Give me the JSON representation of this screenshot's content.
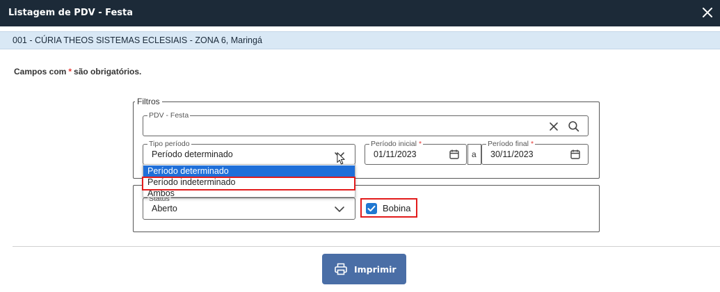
{
  "dialog": {
    "title": "Listagem de PDV - Festa",
    "subtitle": "001 - CÚRIA THEOS SISTEMAS ECLESIAIS - ZONA 6, Maringá"
  },
  "required_note": {
    "prefix": "Campos com",
    "star": "*",
    "suffix": "são obrigatórios."
  },
  "filters": {
    "legend": "Filtros",
    "pdv_festa": {
      "label": "PDV - Festa",
      "value": ""
    },
    "tipo_periodo": {
      "label": "Tipo período",
      "value": "Período determinado",
      "options": [
        "Período determinado",
        "Período indeterminado",
        "Ambos"
      ],
      "selected_index": 0,
      "hovered_index": 1
    },
    "periodo_inicial": {
      "label": "Período inicial",
      "star": "*",
      "value": "01/11/2023"
    },
    "between": "a",
    "periodo_final": {
      "label": "Período final",
      "star": "*",
      "value": "30/11/2023"
    }
  },
  "options_group": {
    "status": {
      "label": "Status",
      "value": "Aberto"
    },
    "bobina": {
      "label": "Bobina",
      "checked": true
    }
  },
  "actions": {
    "print_label": "Imprimir"
  },
  "colors": {
    "titlebar": "#1c2a38",
    "subbar": "#d9e8f5",
    "accent": "#1f78d1",
    "selected_option": "#1f6fd9",
    "highlight": "#e21b1b",
    "print_button": "#4a6ea6",
    "required_star": "#e53935"
  },
  "icons": [
    "close-icon",
    "clear-icon",
    "search-icon",
    "chevron-down-icon",
    "calendar-icon",
    "checkmark-icon",
    "printer-icon",
    "mouse-cursor-icon"
  ]
}
